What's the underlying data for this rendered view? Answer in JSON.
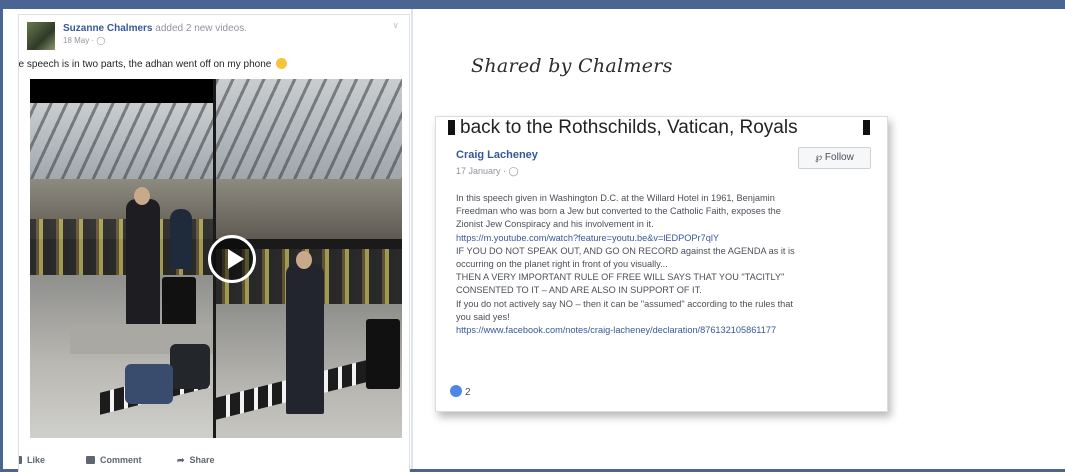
{
  "colors": {
    "frame": "#4a6592",
    "link": "#365899",
    "muted": "#90949c"
  },
  "left_post": {
    "author": "Suzanne Chalmers",
    "action_text": " added 2 new videos.",
    "date": "18 May · ",
    "privacy_icon": "globe-icon",
    "text": "he speech is in two parts, the adhan went off on my phone",
    "emoji": "smiley-emoji",
    "actions": [
      {
        "label": "Like",
        "icon": "thumbs-up-icon"
      },
      {
        "label": "Comment",
        "icon": "comment-icon"
      },
      {
        "label": "Share",
        "icon": "share-icon"
      }
    ]
  },
  "right_panel": {
    "heading": "Shared by Chalmers",
    "card": {
      "headline": "back to the Rothschilds, Vatican, Royals",
      "author": "Craig Lacheney",
      "date": "17 January · ",
      "follow_label": "Follow",
      "lines": [
        "In this speech given in Washington D.C. at the Willard Hotel in 1961, Benjamin",
        "Freedman who was born a Jew but converted to the Catholic Faith, exposes the",
        "Zionist Jew Conspiracy and his involvement in it.",
        "https://m.youtube.com/watch?feature=youtu.be&v=lEDPOPr7qlY",
        "IF YOU DO NOT SPEAK OUT, AND GO ON RECORD against the AGENDA as it is",
        "occurring on the planet right in front of you visually...",
        "THEN A VERY IMPORTANT RULE OF FREE WILL SAYS THAT YOU \"TACITLY\"",
        "CONSENTED TO IT – AND ARE ALSO IN SUPPORT OF IT.",
        "If you do not actively say NO – then it can be \"assumed\" according to the rules that",
        "you said yes!",
        "https://www.facebook.com/notes/craig-lacheney/declaration/876132105861177"
      ],
      "reaction_count": "2"
    }
  }
}
